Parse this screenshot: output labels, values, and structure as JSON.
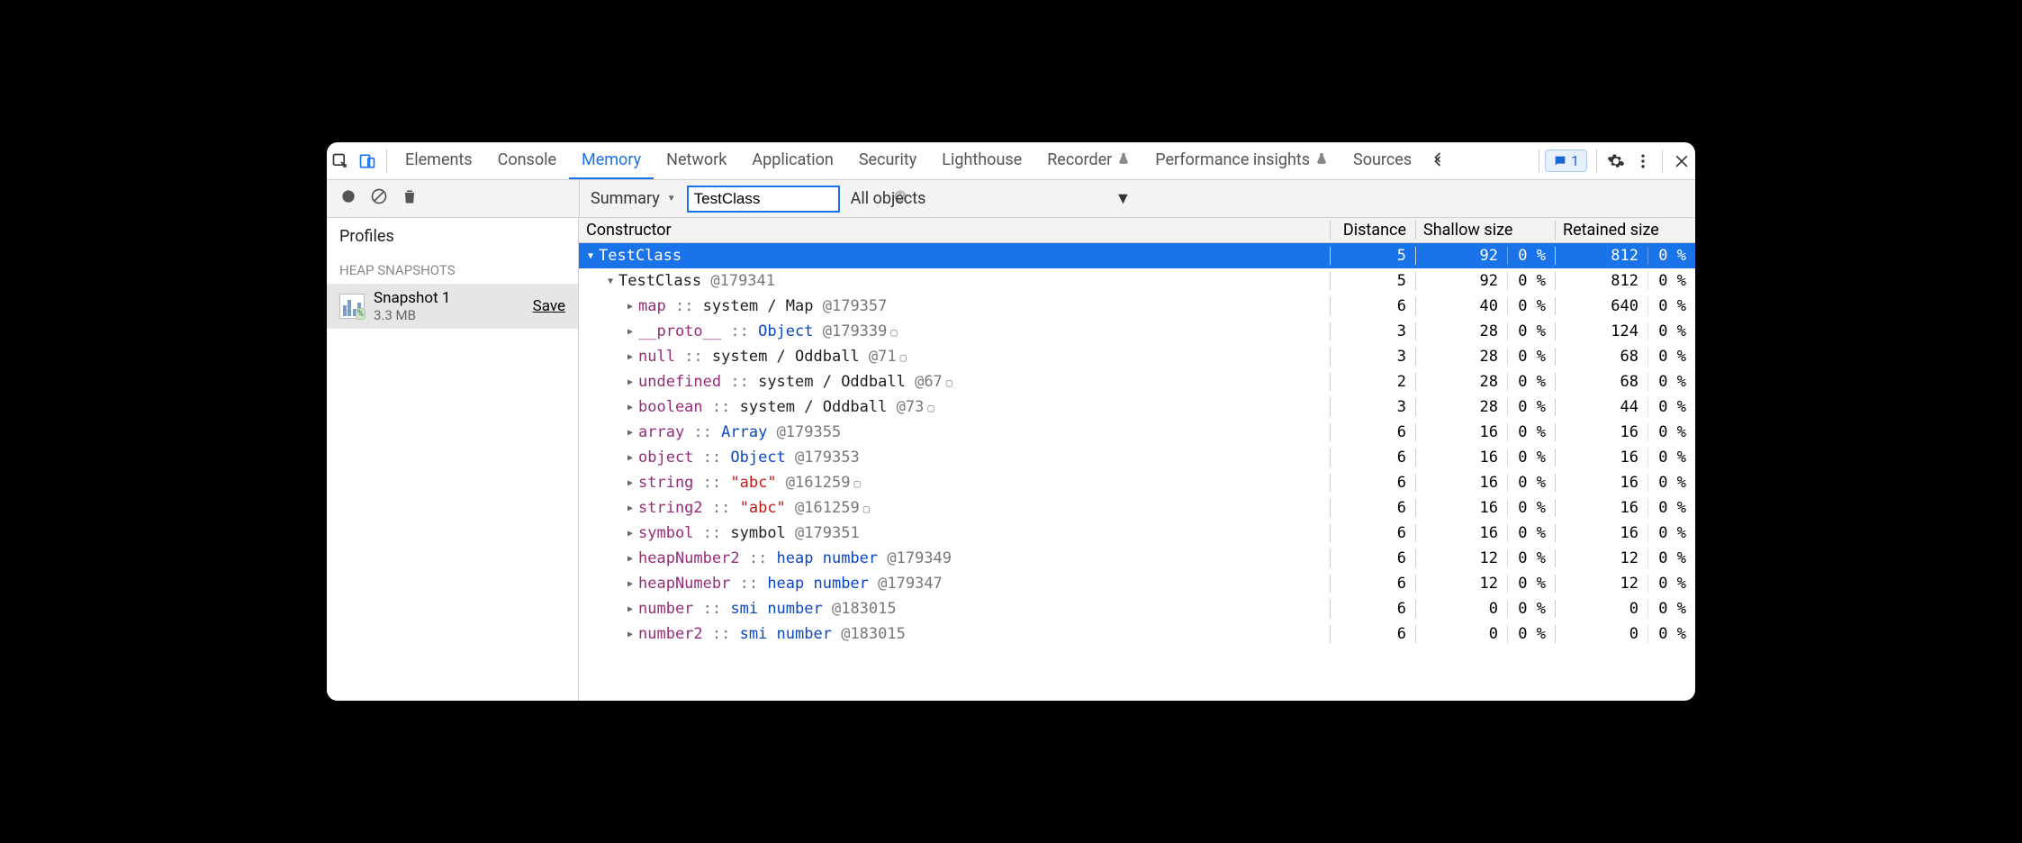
{
  "tabs": [
    "Elements",
    "Console",
    "Memory",
    "Network",
    "Application",
    "Security",
    "Lighthouse",
    "Recorder",
    "Performance insights",
    "Sources"
  ],
  "activeTab": "Memory",
  "experimentalTabs": [
    "Recorder",
    "Performance insights"
  ],
  "errorCount": "1",
  "toolbar": {
    "summary": "Summary",
    "filterValue": "TestClass",
    "objectsScope": "All objects"
  },
  "sidebar": {
    "profilesHeading": "Profiles",
    "sectionHeading": "HEAP SNAPSHOTS",
    "snapshot": {
      "name": "Snapshot 1",
      "size": "3.3 MB",
      "save": "Save"
    }
  },
  "grid": {
    "columns": {
      "constructor": "Constructor",
      "distance": "Distance",
      "shallow": "Shallow size",
      "retained": "Retained size"
    },
    "rows": [
      {
        "depth": 0,
        "open": true,
        "selected": true,
        "parts": [
          {
            "t": "type",
            "v": "TestClass"
          }
        ],
        "d": "5",
        "s": "92",
        "sp": "0 %",
        "r": "812",
        "rp": "0 %"
      },
      {
        "depth": 1,
        "open": true,
        "parts": [
          {
            "t": "type",
            "v": "TestClass "
          },
          {
            "t": "objid",
            "v": "@179341"
          }
        ],
        "d": "5",
        "s": "92",
        "sp": "0 %",
        "r": "812",
        "rp": "0 %"
      },
      {
        "depth": 2,
        "parts": [
          {
            "t": "prop",
            "v": "map"
          },
          {
            "t": "sep",
            "v": " :: "
          },
          {
            "t": "type",
            "v": "system / Map "
          },
          {
            "t": "objid",
            "v": "@179357"
          }
        ],
        "d": "6",
        "s": "40",
        "sp": "0 %",
        "r": "640",
        "rp": "0 %"
      },
      {
        "depth": 2,
        "parts": [
          {
            "t": "prop",
            "v": "__proto__"
          },
          {
            "t": "sep",
            "v": " :: "
          },
          {
            "t": "link",
            "v": "Object "
          },
          {
            "t": "objid",
            "v": "@179339"
          }
        ],
        "sq": true,
        "d": "3",
        "s": "28",
        "sp": "0 %",
        "r": "124",
        "rp": "0 %"
      },
      {
        "depth": 2,
        "parts": [
          {
            "t": "prop",
            "v": "null"
          },
          {
            "t": "sep",
            "v": " :: "
          },
          {
            "t": "type",
            "v": "system / Oddball "
          },
          {
            "t": "objid",
            "v": "@71"
          }
        ],
        "sq": true,
        "d": "3",
        "s": "28",
        "sp": "0 %",
        "r": "68",
        "rp": "0 %"
      },
      {
        "depth": 2,
        "parts": [
          {
            "t": "prop",
            "v": "undefined"
          },
          {
            "t": "sep",
            "v": " :: "
          },
          {
            "t": "type",
            "v": "system / Oddball "
          },
          {
            "t": "objid",
            "v": "@67"
          }
        ],
        "sq": true,
        "d": "2",
        "s": "28",
        "sp": "0 %",
        "r": "68",
        "rp": "0 %"
      },
      {
        "depth": 2,
        "parts": [
          {
            "t": "prop",
            "v": "boolean"
          },
          {
            "t": "sep",
            "v": " :: "
          },
          {
            "t": "type",
            "v": "system / Oddball "
          },
          {
            "t": "objid",
            "v": "@73"
          }
        ],
        "sq": true,
        "d": "3",
        "s": "28",
        "sp": "0 %",
        "r": "44",
        "rp": "0 %"
      },
      {
        "depth": 2,
        "parts": [
          {
            "t": "prop",
            "v": "array"
          },
          {
            "t": "sep",
            "v": " :: "
          },
          {
            "t": "link",
            "v": "Array "
          },
          {
            "t": "objid",
            "v": "@179355"
          }
        ],
        "d": "6",
        "s": "16",
        "sp": "0 %",
        "r": "16",
        "rp": "0 %"
      },
      {
        "depth": 2,
        "parts": [
          {
            "t": "prop",
            "v": "object"
          },
          {
            "t": "sep",
            "v": " :: "
          },
          {
            "t": "link",
            "v": "Object "
          },
          {
            "t": "objid",
            "v": "@179353"
          }
        ],
        "d": "6",
        "s": "16",
        "sp": "0 %",
        "r": "16",
        "rp": "0 %"
      },
      {
        "depth": 2,
        "parts": [
          {
            "t": "prop",
            "v": "string"
          },
          {
            "t": "sep",
            "v": " :: "
          },
          {
            "t": "str",
            "v": "\"abc\" "
          },
          {
            "t": "objid",
            "v": "@161259"
          }
        ],
        "sq": true,
        "d": "6",
        "s": "16",
        "sp": "0 %",
        "r": "16",
        "rp": "0 %"
      },
      {
        "depth": 2,
        "parts": [
          {
            "t": "prop",
            "v": "string2"
          },
          {
            "t": "sep",
            "v": " :: "
          },
          {
            "t": "str",
            "v": "\"abc\" "
          },
          {
            "t": "objid",
            "v": "@161259"
          }
        ],
        "sq": true,
        "d": "6",
        "s": "16",
        "sp": "0 %",
        "r": "16",
        "rp": "0 %"
      },
      {
        "depth": 2,
        "parts": [
          {
            "t": "prop",
            "v": "symbol"
          },
          {
            "t": "sep",
            "v": " :: "
          },
          {
            "t": "type",
            "v": "symbol "
          },
          {
            "t": "objid",
            "v": "@179351"
          }
        ],
        "d": "6",
        "s": "16",
        "sp": "0 %",
        "r": "16",
        "rp": "0 %"
      },
      {
        "depth": 2,
        "parts": [
          {
            "t": "prop",
            "v": "heapNumber2"
          },
          {
            "t": "sep",
            "v": " :: "
          },
          {
            "t": "link",
            "v": "heap number "
          },
          {
            "t": "objid",
            "v": "@179349"
          }
        ],
        "d": "6",
        "s": "12",
        "sp": "0 %",
        "r": "12",
        "rp": "0 %"
      },
      {
        "depth": 2,
        "parts": [
          {
            "t": "prop",
            "v": "heapNumebr"
          },
          {
            "t": "sep",
            "v": " :: "
          },
          {
            "t": "link",
            "v": "heap number "
          },
          {
            "t": "objid",
            "v": "@179347"
          }
        ],
        "d": "6",
        "s": "12",
        "sp": "0 %",
        "r": "12",
        "rp": "0 %"
      },
      {
        "depth": 2,
        "parts": [
          {
            "t": "prop",
            "v": "number"
          },
          {
            "t": "sep",
            "v": " :: "
          },
          {
            "t": "link",
            "v": "smi number "
          },
          {
            "t": "objid",
            "v": "@183015"
          }
        ],
        "d": "6",
        "s": "0",
        "sp": "0 %",
        "r": "0",
        "rp": "0 %"
      },
      {
        "depth": 2,
        "parts": [
          {
            "t": "prop",
            "v": "number2"
          },
          {
            "t": "sep",
            "v": " :: "
          },
          {
            "t": "link",
            "v": "smi number "
          },
          {
            "t": "objid",
            "v": "@183015"
          }
        ],
        "d": "6",
        "s": "0",
        "sp": "0 %",
        "r": "0",
        "rp": "0 %"
      }
    ]
  }
}
